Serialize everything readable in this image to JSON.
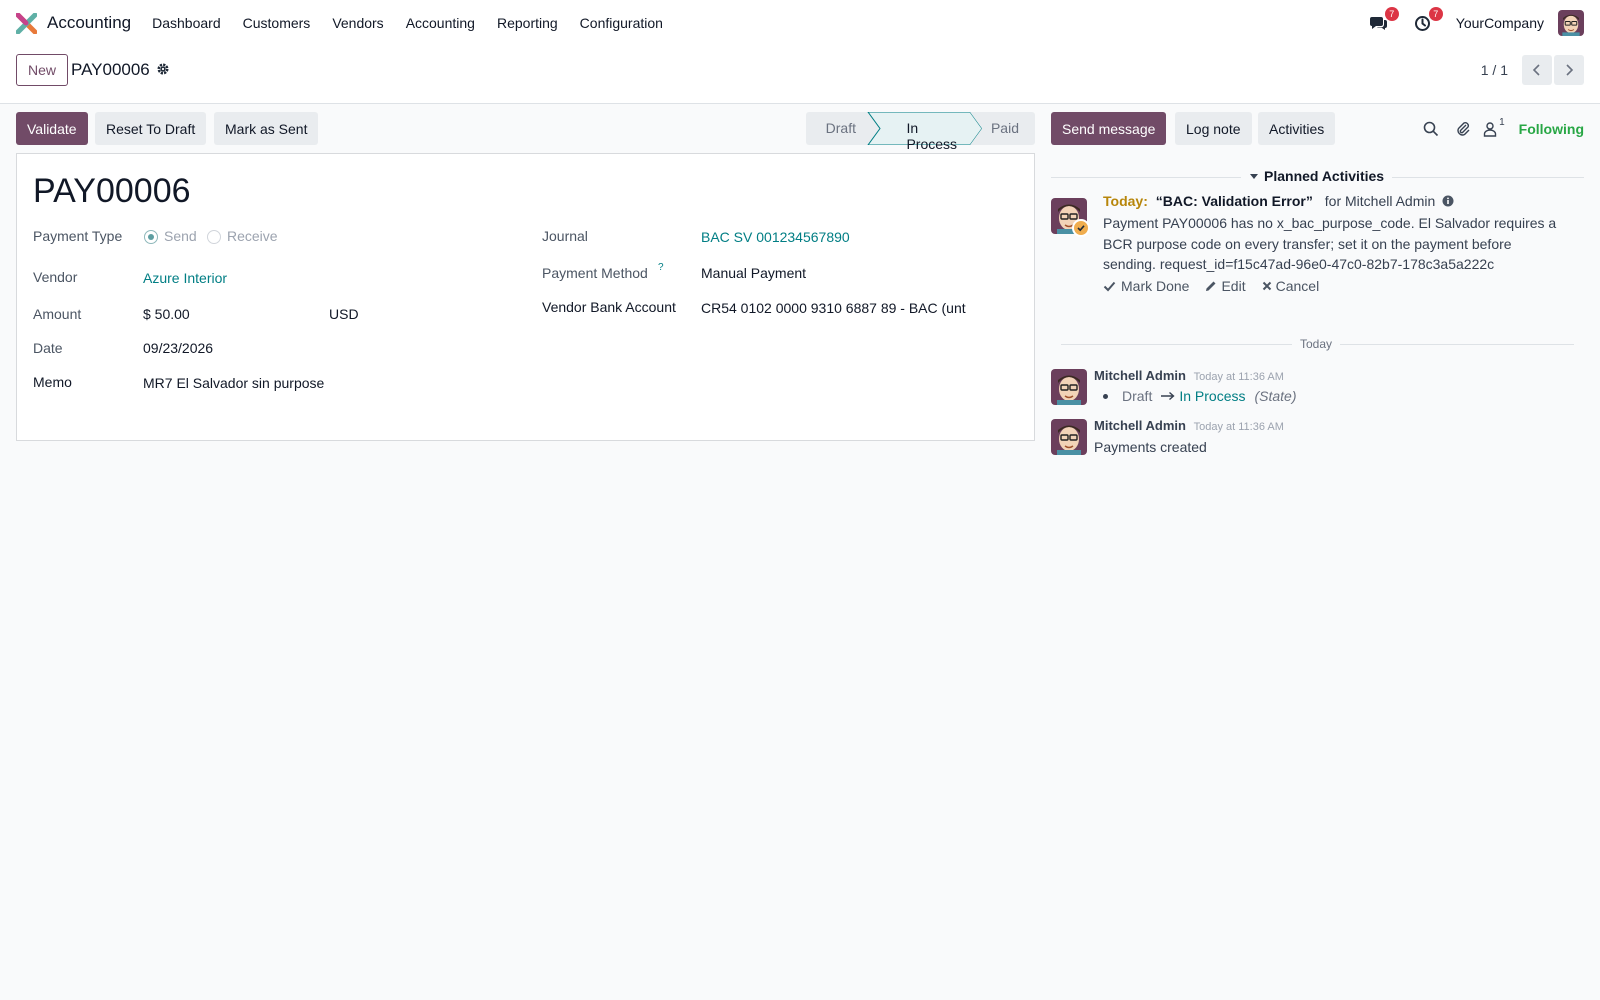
{
  "navbar": {
    "app_name": "Accounting",
    "menu": [
      "Dashboard",
      "Customers",
      "Vendors",
      "Accounting",
      "Reporting",
      "Configuration"
    ],
    "messages_count": "7",
    "activities_count": "7",
    "company": "YourCompany"
  },
  "control_panel": {
    "new_label": "New",
    "breadcrumb": "PAY00006",
    "pager": "1 / 1"
  },
  "statusbar": {
    "validate": "Validate",
    "reset": "Reset To Draft",
    "mark_sent": "Mark as Sent",
    "stages": [
      "Draft",
      "In Process",
      "Paid"
    ],
    "current_stage": "In Process"
  },
  "form": {
    "name": "PAY00006",
    "payment_type_label": "Payment Type",
    "payment_type_options": [
      "Send",
      "Receive"
    ],
    "payment_type_selected": "Send",
    "vendor_label": "Vendor",
    "vendor": "Azure Interior",
    "amount_label": "Amount",
    "amount": "$ 50.00",
    "currency": "USD",
    "date_label": "Date",
    "date": "09/23/2026",
    "memo_label": "Memo",
    "memo": "MR7 El Salvador sin purpose",
    "journal_label": "Journal",
    "journal": "BAC SV 001234567890",
    "payment_method_label": "Payment Method",
    "payment_method_help": "?",
    "payment_method": "Manual Payment",
    "bank_account_label": "Vendor Bank Account",
    "bank_account": "CR54 0102 0000 9310 6887 89 - BAC (unt"
  },
  "chatter": {
    "send_message": "Send message",
    "log_note": "Log note",
    "activities": "Activities",
    "followers_count": "1",
    "following": "Following",
    "planned_title": "Planned Activities",
    "activity": {
      "when": "Today:",
      "summary": "“BAC: Validation Error”",
      "for": "for Mitchell Admin",
      "note": "Payment PAY00006 has no x_bac_purpose_code. El Salvador requires a BCR purpose code on every transfer; set it on the payment before sending. request_id=f15c47ad-96e0-47c0-82b7-178c3a5a222c",
      "mark_done": "Mark Done",
      "edit": "Edit",
      "cancel": "Cancel"
    },
    "day_separator": "Today",
    "messages": [
      {
        "author": "Mitchell Admin",
        "time": "Today at 11:36 AM",
        "old_value": "Draft",
        "new_value": "In Process",
        "field": "(State)"
      },
      {
        "author": "Mitchell Admin",
        "time": "Today at 11:36 AM",
        "body": "Payments created"
      }
    ]
  },
  "colors": {
    "primary": "#714b67",
    "link": "#017e84",
    "following": "#28a745",
    "badge": "#dc3545"
  }
}
